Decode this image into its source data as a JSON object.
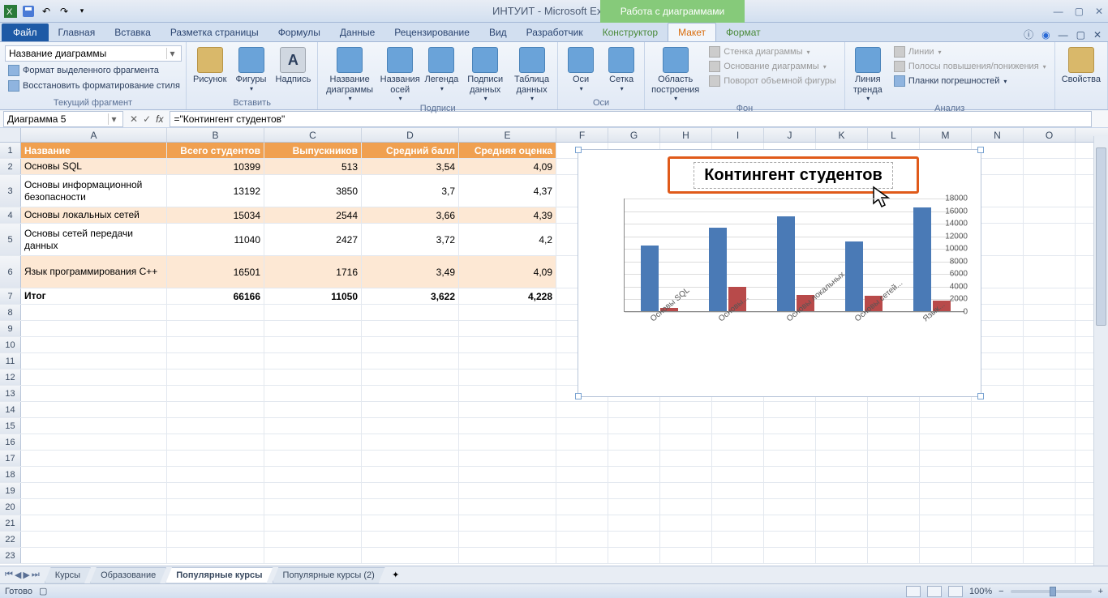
{
  "app": {
    "title": "ИНТУИТ - Microsoft Excel",
    "chart_tools": "Работа с диаграммами"
  },
  "tabs": [
    "Главная",
    "Вставка",
    "Разметка страницы",
    "Формулы",
    "Данные",
    "Рецензирование",
    "Вид",
    "Разработчик",
    "Конструктор",
    "Макет",
    "Формат"
  ],
  "file_tab": "Файл",
  "ribbon": {
    "g1_label": "Текущий фрагмент",
    "selector": "Название диаграммы",
    "fmt_sel": "Формат выделенного фрагмента",
    "reset": "Восстановить форматирование стиля",
    "g2_label": "Вставить",
    "pic": "Рисунок",
    "shapes": "Фигуры",
    "text": "Надпись",
    "g3_label": "Подписи",
    "ct": "Название диаграммы",
    "axt": "Названия осей",
    "leg": "Легенда",
    "dl": "Подписи данных",
    "dt": "Таблица данных",
    "g4_label": "Оси",
    "axes": "Оси",
    "grid": "Сетка",
    "g5_label": "Фон",
    "plotarea": "Область построения",
    "cw": "Стенка диаграммы",
    "cf": "Основание диаграммы",
    "rot": "Поворот объемной фигуры",
    "g6_label": "Анализ",
    "trend": "Линия тренда",
    "lines": "Линии",
    "updown": "Полосы повышения/понижения",
    "err": "Планки погрешностей",
    "g7": "Свойства"
  },
  "namebox": "Диаграмма 5",
  "formula": "=\"Контингент студентов\"",
  "columns": [
    "A",
    "B",
    "C",
    "D",
    "E",
    "F",
    "G",
    "H",
    "I",
    "J",
    "K",
    "L",
    "M",
    "N",
    "O"
  ],
  "header_row": [
    "Название",
    "Всего студентов",
    "Выпускников",
    "Средний балл",
    "Средняя оценка"
  ],
  "data_rows": [
    {
      "n": "2",
      "a": "Основы SQL",
      "b": "10399",
      "c": "513",
      "d": "3,54",
      "e": "4,09",
      "stripe": true,
      "tall": false
    },
    {
      "n": "3",
      "a": "Основы информационной безопасности",
      "b": "13192",
      "c": "3850",
      "d": "3,7",
      "e": "4,37",
      "stripe": false,
      "tall": true
    },
    {
      "n": "4",
      "a": "Основы локальных сетей",
      "b": "15034",
      "c": "2544",
      "d": "3,66",
      "e": "4,39",
      "stripe": true,
      "tall": false
    },
    {
      "n": "5",
      "a": "Основы сетей передачи данных",
      "b": "11040",
      "c": "2427",
      "d": "3,72",
      "e": "4,2",
      "stripe": false,
      "tall": true
    },
    {
      "n": "6",
      "a": "Язык программирования C++",
      "b": "16501",
      "c": "1716",
      "d": "3,49",
      "e": "4,09",
      "stripe": true,
      "tall": true
    },
    {
      "n": "7",
      "a": "Итог",
      "b": "66166",
      "c": "11050",
      "d": "3,622",
      "e": "4,228",
      "stripe": false,
      "tall": false,
      "bold": true
    }
  ],
  "empty_rows": [
    "8",
    "9",
    "10",
    "11",
    "12",
    "13",
    "14",
    "15",
    "16",
    "17",
    "18",
    "19",
    "20",
    "21",
    "22",
    "23"
  ],
  "chart_title": "Контингент студентов",
  "sheet_tabs": [
    "Курсы",
    "Образование",
    "Популярные курсы",
    "Популярные курсы (2)"
  ],
  "active_sheet": 2,
  "status": "Готово",
  "zoom": "100%",
  "chart_data": {
    "type": "bar",
    "title": "Контингент студентов",
    "categories": [
      "Основы SQL",
      "Основы...",
      "Основы локальных...",
      "Основы сетей...",
      "Язык..."
    ],
    "series": [
      {
        "name": "Всего студентов",
        "values": [
          10399,
          13192,
          15034,
          11040,
          16501
        ],
        "color": "#4a7ab6"
      },
      {
        "name": "Выпускников",
        "values": [
          513,
          3850,
          2544,
          2427,
          1716
        ],
        "color": "#b84a4a"
      }
    ],
    "ylim": [
      0,
      18000
    ],
    "yticks": [
      0,
      2000,
      4000,
      6000,
      8000,
      10000,
      12000,
      14000,
      16000,
      18000
    ]
  }
}
